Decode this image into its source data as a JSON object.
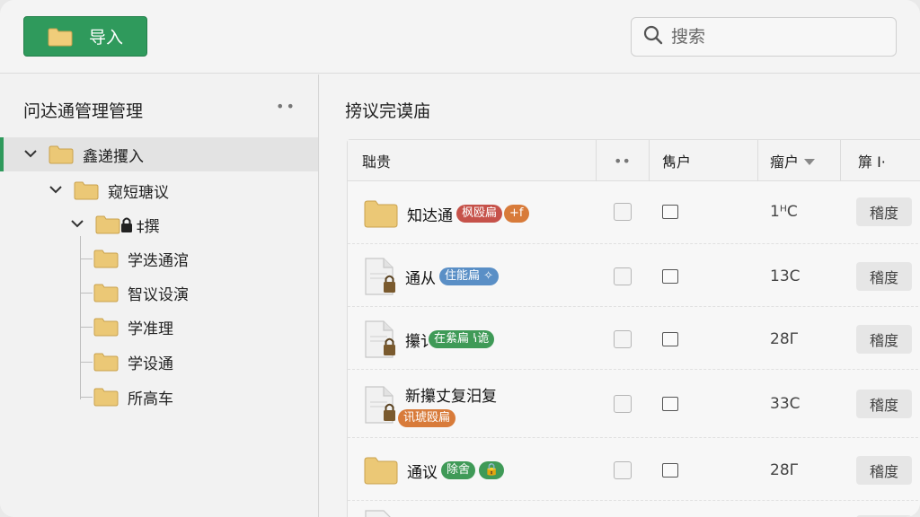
{
  "toolbar": {
    "import_label": "导入",
    "search_placeholder": "搜索"
  },
  "sidebar": {
    "title": "问达通管理管理",
    "more": "••",
    "tree": [
      {
        "label": "鑫递攫入",
        "level": 0,
        "expanded": true,
        "selected": true
      },
      {
        "label": "窥短瑭议",
        "level": 1,
        "expanded": true
      },
      {
        "label": "‡撰",
        "level": 2,
        "expanded": true,
        "locked": true
      },
      {
        "label": "学迭通涫",
        "level": 3
      },
      {
        "label": "智议设演",
        "level": 3
      },
      {
        "label": "学准理",
        "level": 3
      },
      {
        "label": "学设通",
        "level": 3
      },
      {
        "label": "所高车",
        "level": 3
      }
    ]
  },
  "main": {
    "title": "搒议完谟庙",
    "columns": {
      "name": "聉贵",
      "dots": "••",
      "c3": "雋户",
      "c4": "瘤户",
      "c5": "箳 I·"
    },
    "rows": [
      {
        "name": "知达通",
        "icon": "folder",
        "badges": [
          {
            "text": "枫殴扁",
            "color": "red"
          },
          {
            "text": "+f",
            "color": "orange"
          }
        ],
        "size": "1ᴴC",
        "action": "稽度"
      },
      {
        "name": "通从",
        "icon": "doc-locked",
        "badges": [
          {
            "text": "住能扁 ✧",
            "color": "blue"
          }
        ],
        "size": "13C",
        "action": "稽度"
      },
      {
        "name": "攥讠",
        "icon": "doc-locked",
        "badges": [
          {
            "text": "在絫扁 ꝇ诡",
            "color": "green"
          }
        ],
        "size": "28Γ",
        "action": "稽度"
      },
      {
        "name": "新攥丈复汨复",
        "icon": "doc-locked",
        "badges": [
          {
            "text": "讯琥殴扁",
            "color": "orange"
          }
        ],
        "size": "33C",
        "action": "稽度"
      },
      {
        "name": "通议",
        "icon": "folder",
        "badges": [
          {
            "text": "除舍",
            "color": "green"
          },
          {
            "text": "🔒",
            "color": "green"
          }
        ],
        "size": "28Γ",
        "action": "稽度"
      }
    ]
  },
  "colors": {
    "accent": "#2f9a5c",
    "folder": "#e9c878"
  }
}
